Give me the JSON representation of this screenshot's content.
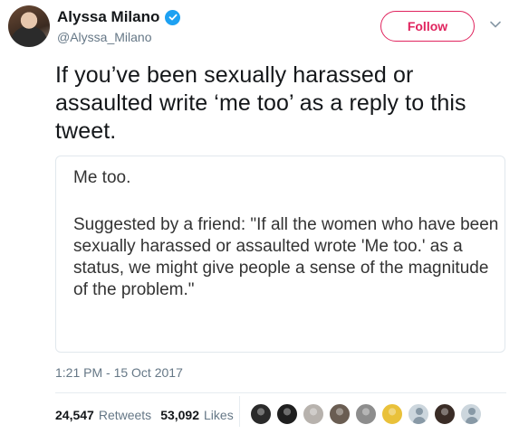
{
  "user": {
    "display_name": "Alyssa Milano",
    "handle": "@Alyssa_Milano",
    "verified": true
  },
  "actions": {
    "follow_label": "Follow",
    "follow_color": "#e0245e",
    "menu_icon": "chevron-down-icon"
  },
  "tweet": {
    "text": "If you’ve been sexually harassed or assaulted write ‘me too’ as a reply to this tweet.",
    "timestamp": "1:21 PM - 15 Oct 2017"
  },
  "attachment": {
    "title": "Me too.",
    "body": "Suggested by a friend: \"If all the women who have been sexually harassed or assaulted wrote 'Me too.' as a status, we might give people a sense of the magnitude of the problem.\""
  },
  "stats": {
    "retweets_count": "24,547",
    "retweets_label": "Retweets",
    "likes_count": "53,092",
    "likes_label": "Likes"
  },
  "likers": [
    {
      "avatar": "photo",
      "color": "#2a2a2a"
    },
    {
      "avatar": "photo",
      "color": "#1f1f1f"
    },
    {
      "avatar": "photo",
      "color": "#b7b2ad"
    },
    {
      "avatar": "photo",
      "color": "#6a5d52"
    },
    {
      "avatar": "photo",
      "color": "#8d8d8d"
    },
    {
      "avatar": "photo",
      "color": "#e9c13a"
    },
    {
      "avatar": "default-egg",
      "color": "#ccd6dd"
    },
    {
      "avatar": "photo",
      "color": "#3a2c26"
    },
    {
      "avatar": "default-egg",
      "color": "#ccd6dd"
    }
  ],
  "colors": {
    "accent": "#1da1f2",
    "secondary_text": "#657786",
    "border": "#e1e8ed"
  }
}
